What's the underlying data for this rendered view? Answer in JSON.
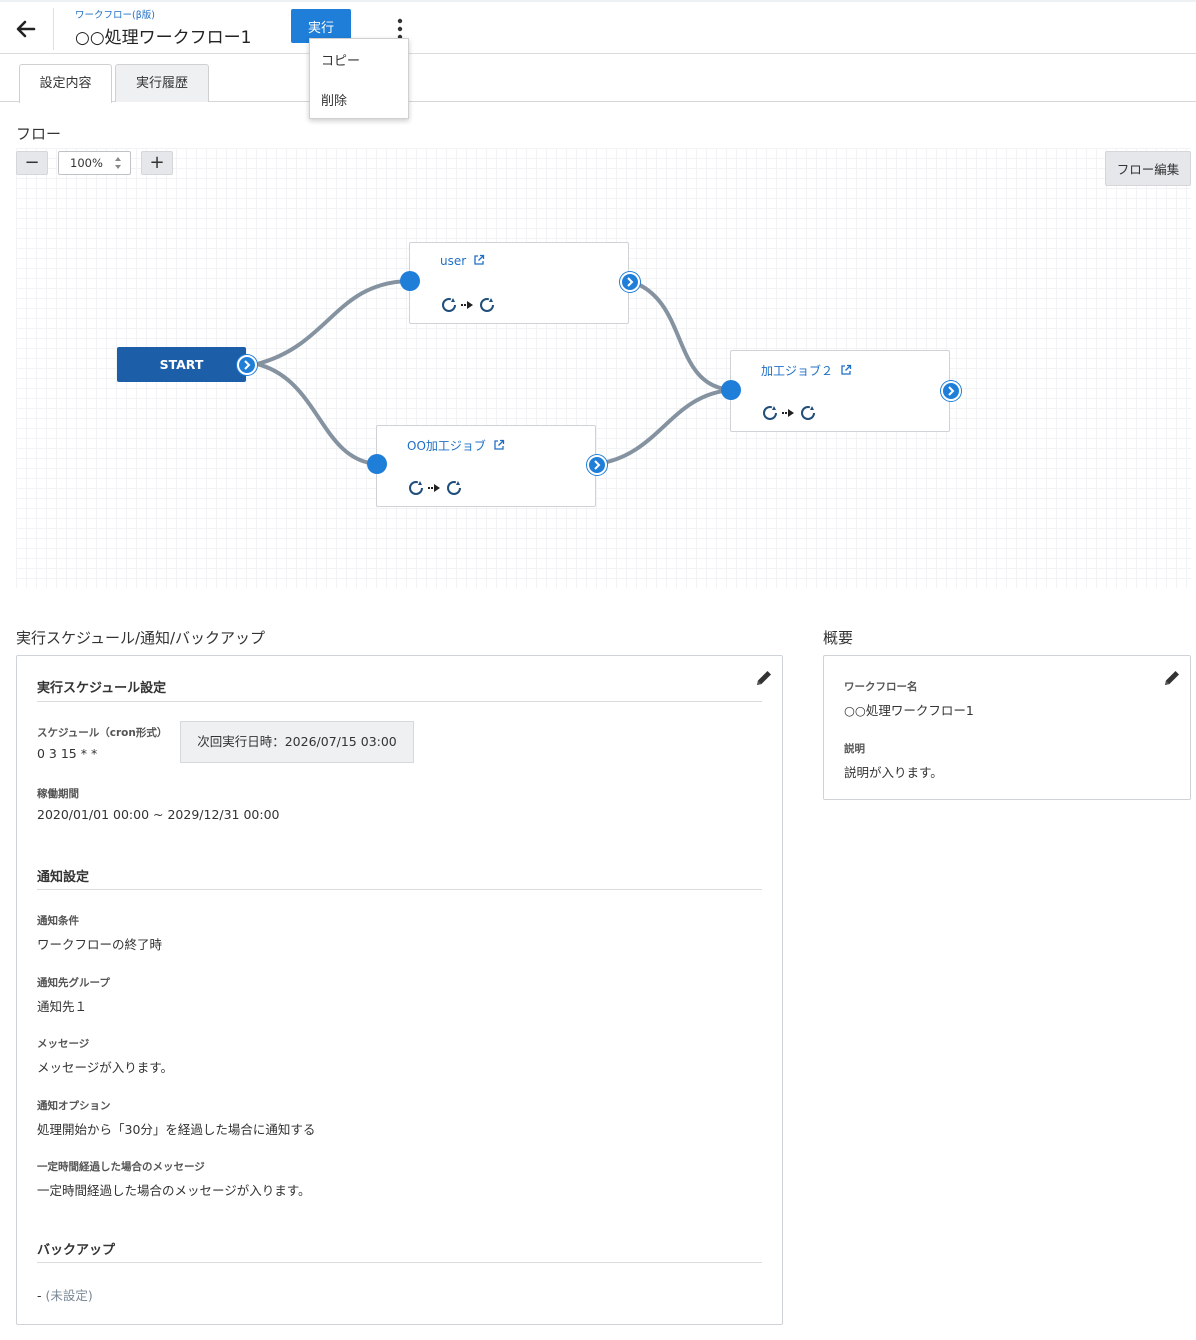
{
  "header": {
    "breadcrumb": "ワークフロー(β版)",
    "title": "○○処理ワークフロー1",
    "run_label": "実行",
    "menu_items": [
      "コピー",
      "削除"
    ]
  },
  "tabs": [
    {
      "label": "設定内容",
      "active": true
    },
    {
      "label": "実行履歴",
      "active": false
    }
  ],
  "flow": {
    "section_title": "フロー",
    "zoom": "100%",
    "zoom_out_label": "−",
    "zoom_in_label": "+",
    "edit_label": "フロー編集",
    "start_label": "START",
    "nodes": [
      {
        "title": "user"
      },
      {
        "title": "OO加工ジョブ"
      },
      {
        "title": "加工ジョブ２"
      }
    ]
  },
  "schedule_section": {
    "title": "実行スケジュール/通知/バックアップ",
    "schedule": {
      "heading": "実行スケジュール設定",
      "cron_label": "スケジュール（cron形式）",
      "cron_value": "0 3 15 * *",
      "next_run": "次回実行日時：2026/07/15 03:00",
      "period_label": "稼働期間",
      "period_value": "2020/01/01 00:00 ~ 2029/12/31 00:00"
    },
    "notification": {
      "heading": "通知設定",
      "condition_label": "通知条件",
      "condition_value": "ワークフローの終了時",
      "group_label": "通知先グループ",
      "group_value": "通知先１",
      "message_label": "メッセージ",
      "message_value": "メッセージが入ります。",
      "option_label": "通知オプション",
      "option_value": "処理開始から「30分」を経過した場合に通知する",
      "timeout_message_label": "一定時間経過した場合のメッセージ",
      "timeout_message_value": "一定時間経過した場合のメッセージが入ります。"
    },
    "backup": {
      "heading": "バックアップ",
      "dash": "-",
      "value": "(未設定)"
    }
  },
  "overview": {
    "title": "概要",
    "name_label": "ワークフロー名",
    "name_value": "○○処理ワークフロー1",
    "desc_label": "説明",
    "desc_value": "説明が入ります。"
  },
  "icons": [
    "back-arrow-icon",
    "kebab-menu-icon",
    "external-link-icon",
    "cycle-icon",
    "dotted-arrow-icon",
    "pencil-icon",
    "chevron-right-icon"
  ],
  "colors": {
    "accent": "#1f7ed8",
    "start": "#1d5ea8",
    "link": "#1f6fc5",
    "connector": "#8592a0"
  }
}
